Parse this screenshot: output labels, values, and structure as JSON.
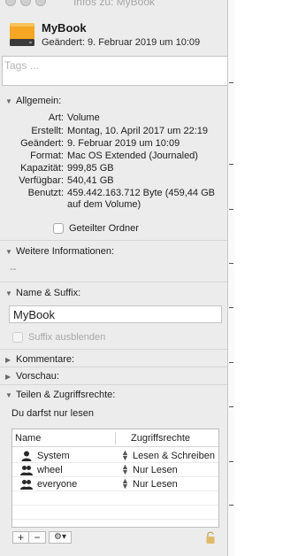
{
  "window": {
    "title": "Infos zu: MyBook"
  },
  "header": {
    "name": "MyBook",
    "modified": "Geändert: 9. Februar 2019 um 10:09"
  },
  "tags": {
    "placeholder": "Tags ..."
  },
  "general": {
    "title": "Allgemein:",
    "rows": [
      {
        "key": "Art:",
        "value": "Volume"
      },
      {
        "key": "Erstellt:",
        "value": "Montag, 10. April 2017 um 22:19"
      },
      {
        "key": "Geändert:",
        "value": "9. Februar 2019 um 10:09"
      },
      {
        "key": "Format:",
        "value": "Mac OS Extended (Journaled)"
      },
      {
        "key": "Kapazität:",
        "value": "999,85 GB"
      },
      {
        "key": "Verfügbar:",
        "value": "540,41 GB"
      },
      {
        "key": "Benutzt:",
        "value": "459.442.163.712 Byte (459,44 GB auf dem Volume)"
      }
    ],
    "shared_folder": "Geteilter Ordner"
  },
  "more_info": {
    "title": "Weitere Informationen:",
    "value": "--"
  },
  "name_ext": {
    "title": "Name & Suffix:",
    "value": "MyBook",
    "hide_ext": "Suffix ausblenden"
  },
  "comments": {
    "title": "Kommentare:"
  },
  "preview": {
    "title": "Vorschau:"
  },
  "sharing": {
    "title": "Teilen & Zugriffsrechte:",
    "note": "Du darfst nur lesen",
    "col_name": "Name",
    "col_priv": "Zugriffsrechte",
    "rows": [
      {
        "name": "System",
        "privilege": "Lesen & Schreiben",
        "icon": "user-icon"
      },
      {
        "name": "wheel",
        "privilege": "Nur Lesen",
        "icon": "group-icon"
      },
      {
        "name": "everyone",
        "privilege": "Nur Lesen",
        "icon": "group-icon"
      }
    ]
  },
  "toolbar": {
    "add": "+",
    "remove": "−",
    "action": "⚙▾"
  },
  "colors": {
    "drive_orange": "#f5a623",
    "drive_dark": "#3a3a3a"
  }
}
